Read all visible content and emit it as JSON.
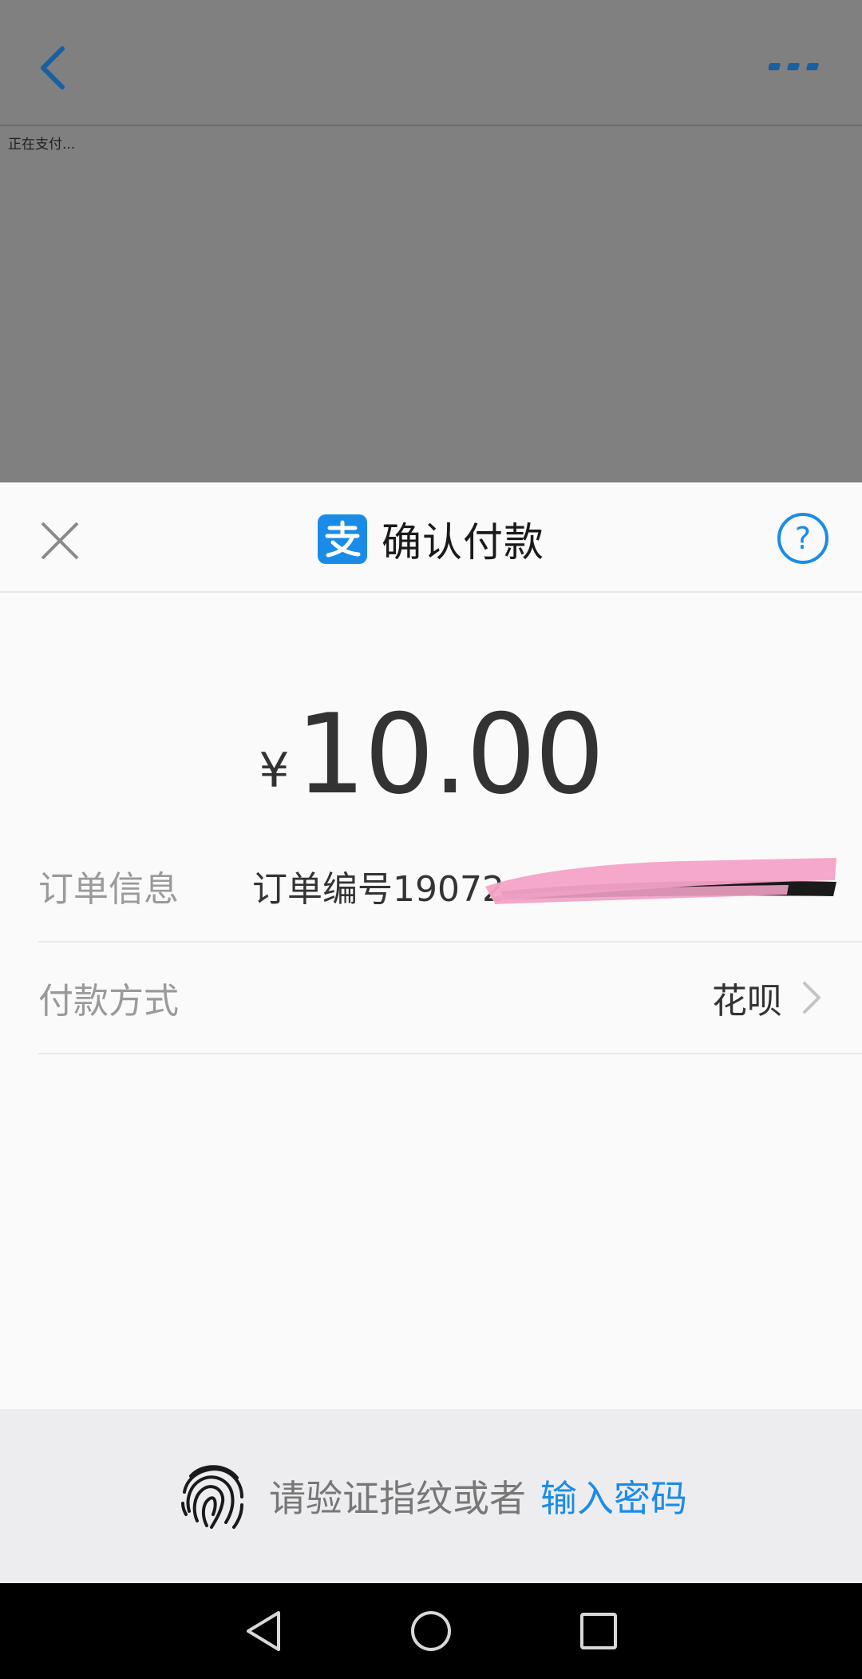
{
  "page": {
    "loading_text": "正在支付..."
  },
  "sheet": {
    "title": "确认付款",
    "currency_symbol": "¥",
    "amount": "10.00",
    "order_label": "订单信息",
    "order_value": "订单编号19072",
    "pay_method_label": "付款方式",
    "pay_method_value": "花呗",
    "help_glyph": "?"
  },
  "verify": {
    "prompt": "请验证指纹或者",
    "link": "输入密码"
  },
  "icons": {
    "back": "chevron-left-icon",
    "more": "more-dots-icon",
    "close": "close-icon",
    "logo": "alipay-logo-icon",
    "help": "help-icon",
    "chevron": "chevron-right-icon",
    "fingerprint": "fingerprint-icon",
    "nav_back": "nav-back-icon",
    "nav_home": "nav-home-icon",
    "nav_recent": "nav-recent-icon"
  },
  "colors": {
    "accent": "#1a8ce8",
    "overlay": "#808080",
    "sheet_bg": "#fafafa",
    "footer_bg": "#ededf0"
  }
}
